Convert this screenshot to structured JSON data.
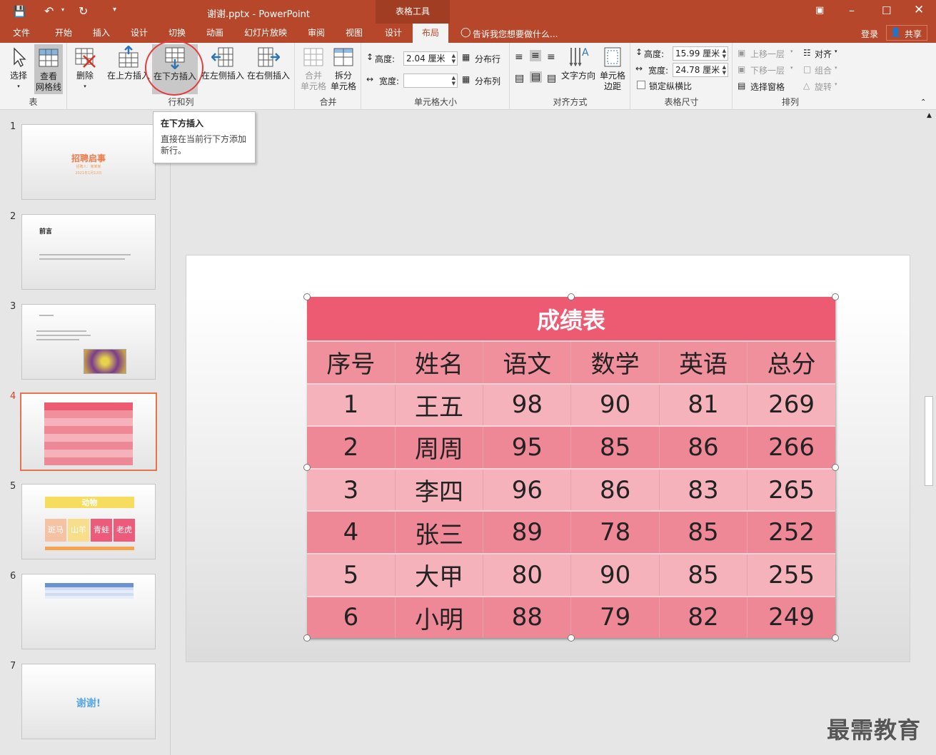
{
  "title_bar": {
    "doc_title": "谢谢.pptx - PowerPoint",
    "context_tab": "表格工具"
  },
  "tabs": [
    "文件",
    "开始",
    "插入",
    "设计",
    "切换",
    "动画",
    "幻灯片放映",
    "审阅",
    "视图",
    "设计",
    "布局"
  ],
  "active_tab": "布局",
  "tell_me": "告诉我您想要做什么...",
  "signin": "登录",
  "share": "共享",
  "ribbon": {
    "table_group": {
      "label": "表",
      "select": "选择",
      "view_grid_1": "查看",
      "view_grid_2": "网格线"
    },
    "rows_cols_group": {
      "label": "行和列",
      "delete": "删除",
      "insert_above": "在上方插入",
      "insert_below": "在下方插入",
      "insert_left": "在左侧插入",
      "insert_right": "在右侧插入"
    },
    "merge_group": {
      "label": "合并",
      "merge_1": "合并",
      "merge_2": "单元格",
      "split_1": "拆分",
      "split_2": "单元格"
    },
    "cell_size_group": {
      "label": "单元格大小",
      "height_label": "高度:",
      "height_value": "2.04 厘米",
      "width_label": "宽度:",
      "width_value": "",
      "dist_rows": "分布行",
      "dist_cols": "分布列"
    },
    "align_group": {
      "label": "对齐方式",
      "text_dir": "文字方向",
      "margins_1": "单元格",
      "margins_2": "边距"
    },
    "table_size_group": {
      "label": "表格尺寸",
      "height_label": "高度:",
      "height_value": "15.99 厘米",
      "width_label": "宽度:",
      "width_value": "24.78 厘米",
      "lock_ratio": "锁定纵横比"
    },
    "arrange_group": {
      "label": "排列",
      "bring_forward": "上移一层",
      "send_backward": "下移一层",
      "selection_pane": "选择窗格",
      "align": "对齐",
      "group": "组合",
      "rotate": "旋转"
    }
  },
  "tooltip": {
    "title": "在下方插入",
    "body": "直接在当前行下方添加新行。"
  },
  "thumbnails": {
    "numbers": [
      "1",
      "2",
      "3",
      "4",
      "5",
      "6",
      "7"
    ],
    "s1_title": "招聘启事",
    "s1_sub1": "招聘人：某某某",
    "s1_sub2": "2021年1月12日",
    "s2_title": "前言",
    "s5_title": "动物",
    "s5_cells": [
      "斑马",
      "山羊",
      "青蛙",
      "老虎"
    ],
    "s7_title": "谢谢!"
  },
  "table": {
    "title": "成绩表",
    "headers": [
      "序号",
      "姓名",
      "语文",
      "数学",
      "英语",
      "总分"
    ],
    "rows": [
      [
        "1",
        "王五",
        "98",
        "90",
        "81",
        "269"
      ],
      [
        "2",
        "周周",
        "95",
        "85",
        "86",
        "266"
      ],
      [
        "3",
        "李四",
        "96",
        "86",
        "83",
        "265"
      ],
      [
        "4",
        "张三",
        "89",
        "78",
        "85",
        "252"
      ],
      [
        "5",
        "大甲",
        "80",
        "90",
        "85",
        "255"
      ],
      [
        "6",
        "小明",
        "88",
        "79",
        "82",
        "249"
      ]
    ]
  },
  "watermark": "最需教育",
  "colors": {
    "brand": "#b7472a",
    "table_title": "#ec5b72",
    "table_header": "#f1909d",
    "row_light": "#f5b2ba",
    "row_dark": "#ef8896"
  }
}
